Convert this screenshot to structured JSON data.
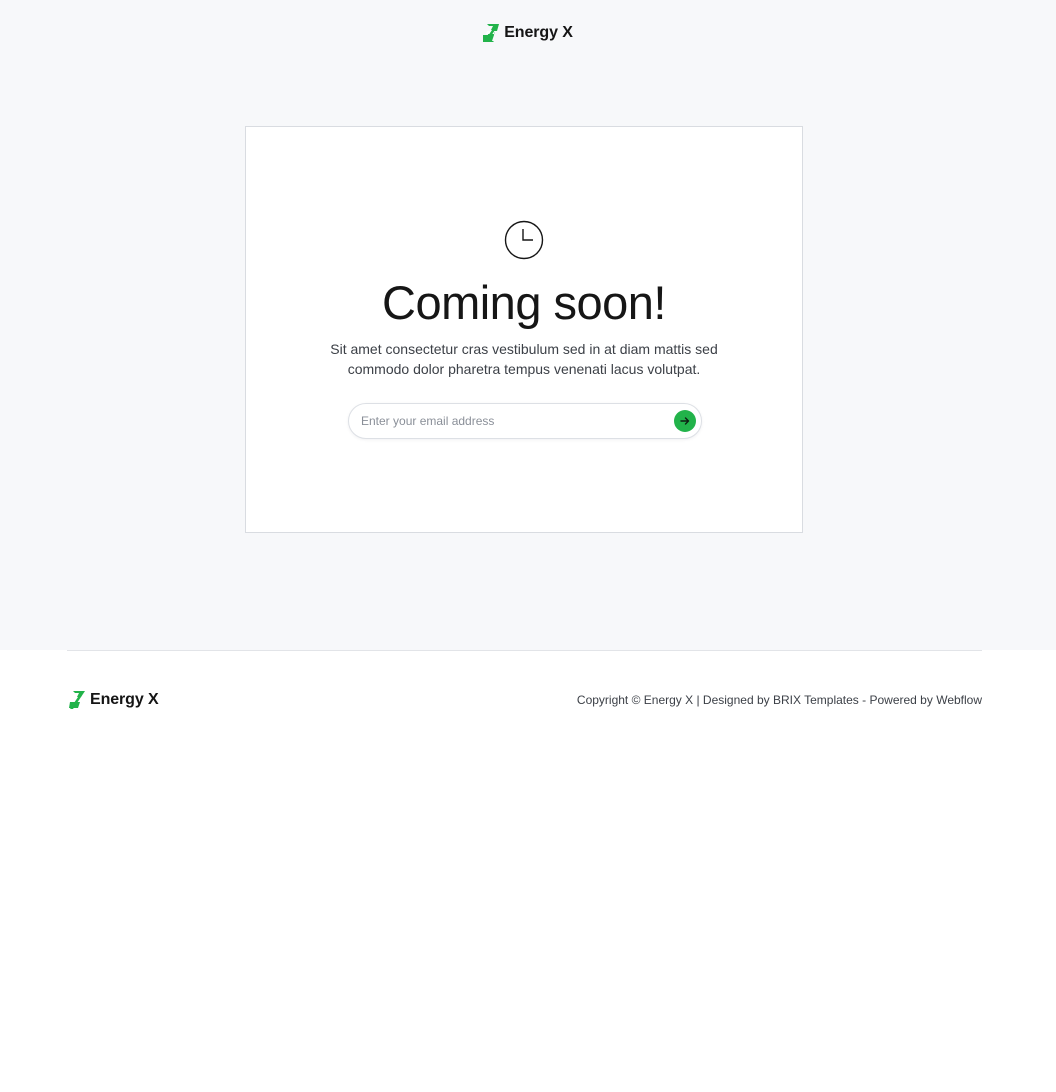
{
  "brand": {
    "name": "Energy X",
    "accent_color": "#22b34a",
    "logo_icon": "lightning-bolt-icon"
  },
  "main": {
    "icon": "clock-icon",
    "title": "Coming soon!",
    "subtitle": "Sit amet consectetur cras vestibulum sed in at diam mattis sed commodo dolor pharetra tempus venenati lacus volutpat.",
    "email_placeholder": "Enter your email address",
    "submit_icon": "arrow-right-icon"
  },
  "footer": {
    "brand_name": "Energy X",
    "copyright_prefix": "Copyright © Energy X | Designed by",
    "designer_link": "BRIX Templates",
    "powered_prefix": "- Powered by",
    "powered_link": "Webflow"
  }
}
